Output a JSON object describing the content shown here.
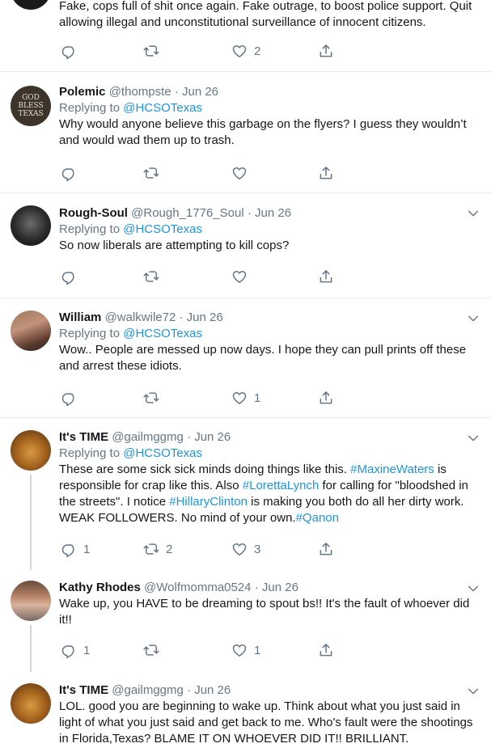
{
  "tweets": [
    {
      "text": "Fake, cops full of shit once again. Fake outrage, to boost police support. Quit allowing illegal and unconstitutional surveillance of innocent citizens.",
      "replies": "",
      "retweets": "",
      "likes": "2"
    },
    {
      "name": "Polemic",
      "handle": "@thompste",
      "dot": "·",
      "date": "Jun 26",
      "replying_prefix": "Replying to ",
      "replying_to": "@HCSOTexas",
      "text": "Why would anyone believe this garbage on the flyers? I guess they wouldn’t and would wad them up to trash.",
      "avatar_text": [
        "GOD",
        "BLESS",
        "TEXAS"
      ],
      "replies": "",
      "retweets": "",
      "likes": ""
    },
    {
      "name": "Rough-Soul",
      "handle": "@Rough_1776_Soul",
      "dot": "·",
      "date": "Jun 26",
      "replying_prefix": "Replying to ",
      "replying_to": "@HCSOTexas",
      "text": "So now liberals are attempting to kill cops?",
      "replies": "",
      "retweets": "",
      "likes": ""
    },
    {
      "name": "William",
      "handle": "@walkwile72",
      "dot": "·",
      "date": "Jun 26",
      "replying_prefix": "Replying to ",
      "replying_to": "@HCSOTexas",
      "text": "Wow.. People are messed up now days. I hope they can pull prints off these and arrest these idiots.",
      "replies": "",
      "retweets": "",
      "likes": "1"
    },
    {
      "name": "It's TIME",
      "handle": "@gailmggmg",
      "dot": "·",
      "date": "Jun 26",
      "replying_prefix": "Replying to ",
      "replying_to": "@HCSOTexas",
      "text_parts": [
        "These are some sick sick minds doing things like this. ",
        "#MaxineWaters",
        " is responsible for crap like this. Also ",
        "#LorettaLynch",
        " for calling for \"bloodshed in the streets\". I notice ",
        "#HillaryClinton",
        " is making you both do all her dirty work. WEAK FOLLOWERS. No mind of your own.",
        "#Qanon"
      ],
      "replies": "1",
      "retweets": "2",
      "likes": "3"
    },
    {
      "name": "Kathy Rhodes",
      "handle": "@Wolfmomma0524",
      "dot": "·",
      "date": "Jun 26",
      "text": "Wake up, you HAVE to be dreaming to spout bs!!  It's the fault of whoever did it!!",
      "replies": "1",
      "retweets": "",
      "likes": "1"
    },
    {
      "name": "It's TIME",
      "handle": "@gailmggmg",
      "dot": "·",
      "date": "Jun 26",
      "text": "LOL. good you are beginning to wake up. Think about what you just said in light of what you just said and get back to me. Who's fault were the shootings in Florida,Texas? BLAME IT ON WHOEVER DID IT!! BRILLIANT."
    }
  ],
  "colors": {
    "link": "#1b95e0",
    "muted": "#657786",
    "divider": "#e6ecf0"
  },
  "icons": [
    "reply-icon",
    "retweet-icon",
    "like-icon",
    "share-icon",
    "chevron-down-icon"
  ]
}
